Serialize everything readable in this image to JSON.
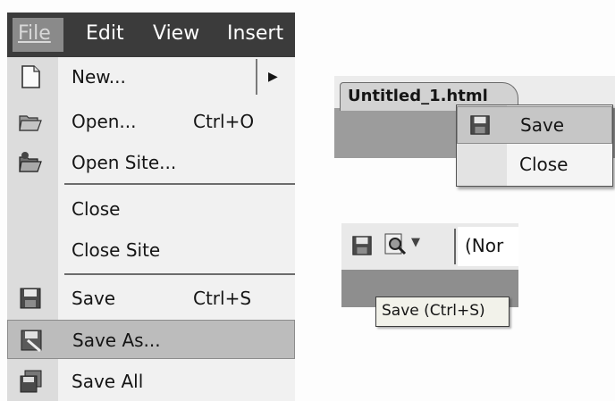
{
  "file_menu": {
    "menubar": {
      "file": "File",
      "edit": "Edit",
      "view": "View",
      "insert": "Insert"
    },
    "items": [
      {
        "label": "New...",
        "shortcut": "",
        "icon": "new-document-icon",
        "has_submenu": true
      },
      {
        "label": "Open...",
        "shortcut": "Ctrl+O",
        "icon": "open-folder-icon"
      },
      {
        "label": "Open Site...",
        "shortcut": "",
        "icon": "open-site-icon"
      },
      {
        "label": "Close",
        "shortcut": ""
      },
      {
        "label": "Close Site",
        "shortcut": ""
      },
      {
        "label": "Save",
        "shortcut": "Ctrl+S",
        "icon": "save-icon"
      },
      {
        "label": "Save As...",
        "shortcut": "",
        "icon": "save-as-icon",
        "highlighted": true
      },
      {
        "label": "Save All",
        "shortcut": "",
        "icon": "save-all-icon"
      }
    ]
  },
  "document_tab": {
    "title": "Untitled_1.html",
    "context_menu": {
      "save": "Save",
      "close": "Close"
    }
  },
  "toolbar": {
    "style_box": "(Nor",
    "tooltip": "Save (Ctrl+S)"
  },
  "colors": {
    "menubar": "#3b3b3b",
    "highlight": "#bcbcbc",
    "gutter": "#dcdcdc"
  }
}
